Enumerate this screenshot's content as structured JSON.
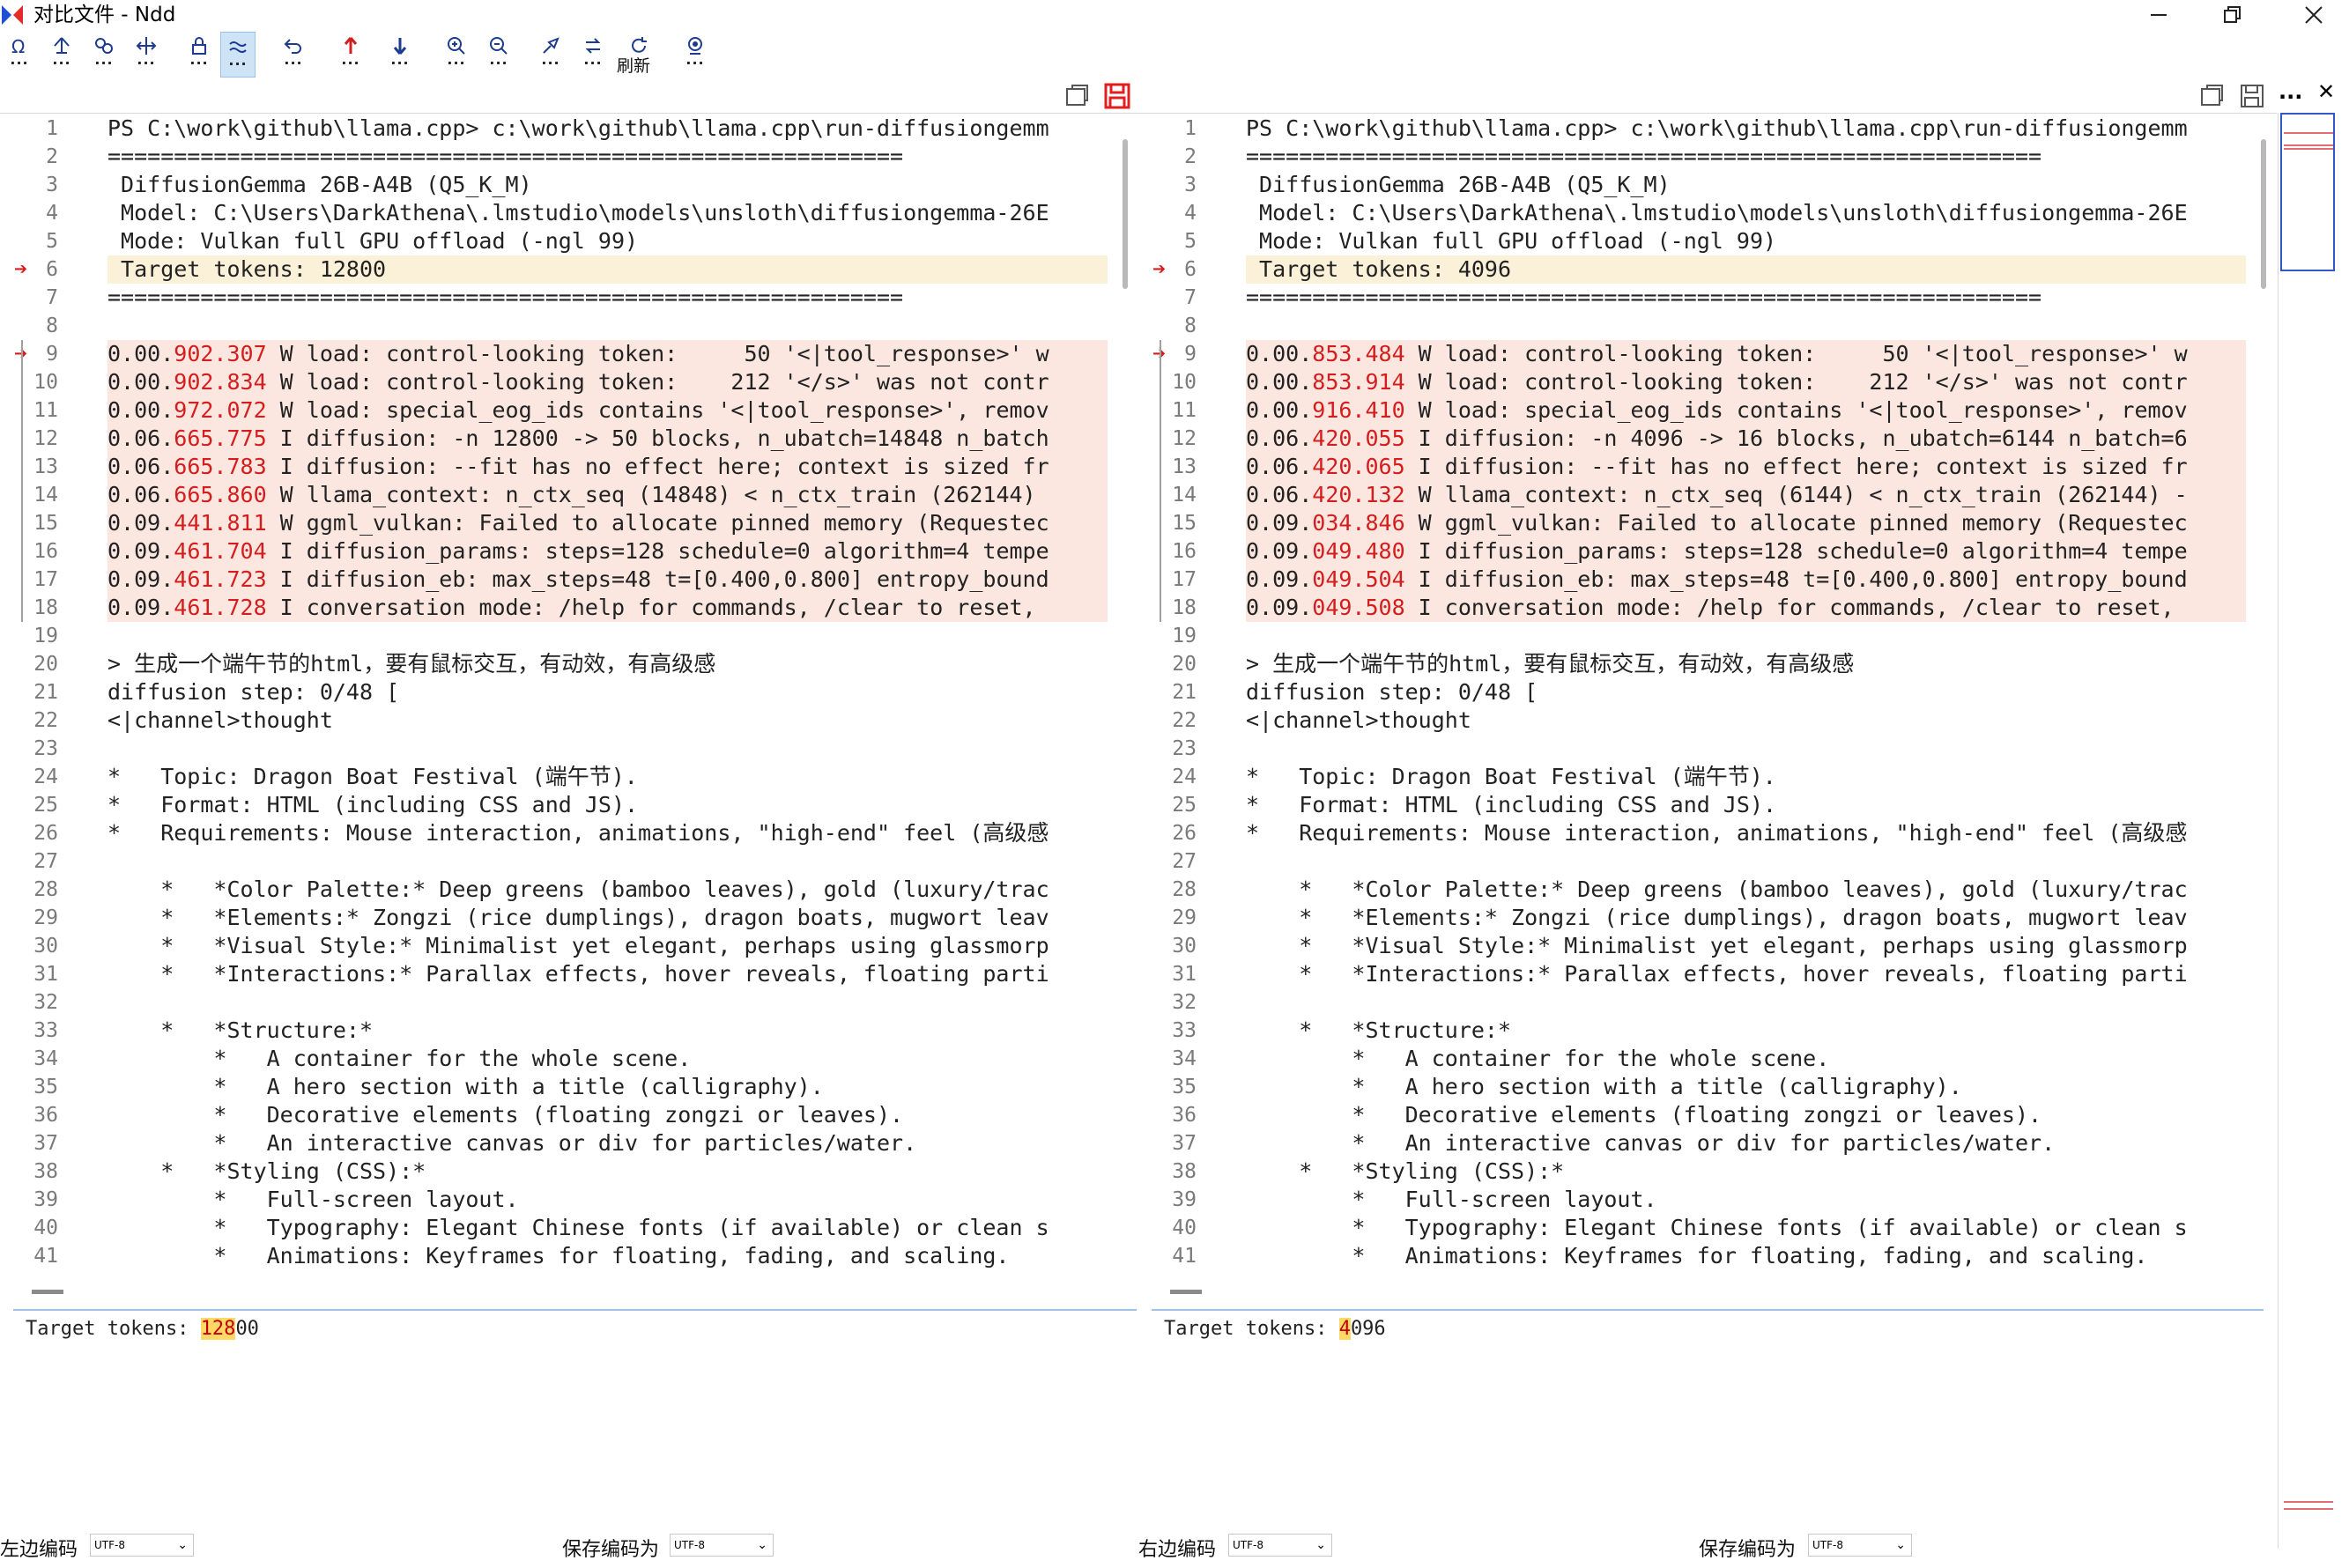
{
  "window": {
    "title": "对比文件 - Ndd",
    "minimize_icon": "minimize-icon",
    "maximize_icon": "restore-icon",
    "close_icon": "close-icon"
  },
  "toolbar": {
    "buttons": [
      {
        "name": "whitespace-icon"
      },
      {
        "name": "prev-diff-block-icon"
      },
      {
        "name": "compare-icon"
      },
      {
        "name": "split-icon"
      },
      {
        "name": "lock-icon"
      },
      {
        "name": "approx-equal-icon"
      },
      {
        "name": "undo-icon"
      },
      {
        "name": "prev-diff-icon"
      },
      {
        "name": "next-diff-icon"
      },
      {
        "name": "zoom-in-icon"
      },
      {
        "name": "zoom-out-icon"
      },
      {
        "name": "clear-icon"
      },
      {
        "name": "sync-icon"
      },
      {
        "name": "refresh-icon"
      },
      {
        "name": "settings-icon"
      }
    ],
    "refresh_label": "刷新"
  },
  "left": {
    "lines": [
      "PS C:\\work\\github\\llama.cpp> c:\\work\\github\\llama.cpp\\run-diffusiongemm",
      "============================================================",
      " DiffusionGemma 26B-A4B (Q5_K_M)",
      " Model: C:\\Users\\DarkAthena\\.lmstudio\\models\\unsloth\\diffusiongemma-26E",
      " Mode: Vulkan full GPU offload (-ngl 99)",
      " Target tokens: 12800",
      "============================================================",
      "",
      "0.00.902.307 W load: control-looking token:     50 '<|tool_response>' w",
      "0.00.902.834 W load: control-looking token:    212 '</s>' was not contr",
      "0.00.972.072 W load: special_eog_ids contains '<|tool_response>', remov",
      "0.06.665.775 I diffusion: -n 12800 -> 50 blocks, n_ubatch=14848 n_batch",
      "0.06.665.783 I diffusion: --fit has no effect here; context is sized fr",
      "0.06.665.860 W llama_context: n_ctx_seq (14848) < n_ctx_train (262144) ",
      "0.09.441.811 W ggml_vulkan: Failed to allocate pinned memory (Requestec",
      "0.09.461.704 I diffusion_params: steps=128 schedule=0 algorithm=4 tempe",
      "0.09.461.723 I diffusion_eb: max_steps=48 t=[0.400,0.800] entropy_bound",
      "0.09.461.728 I conversation mode: /help for commands, /clear to reset,",
      "",
      "> 生成一个端午节的html，要有鼠标交互，有动效，有高级感",
      "diffusion step: 0/48 [",
      "<|channel>thought",
      "",
      "*   Topic: Dragon Boat Festival (端午节).",
      "*   Format: HTML (including CSS and JS).",
      "*   Requirements: Mouse interaction, animations, \"high-end\" feel (高级感",
      "",
      "    *   *Color Palette:* Deep greens (bamboo leaves), gold (luxury/trac",
      "    *   *Elements:* Zongzi (rice dumplings), dragon boats, mugwort leav",
      "    *   *Visual Style:* Minimalist yet elegant, perhaps using glassmorp",
      "    *   *Interactions:* Parallax effects, hover reveals, floating parti",
      "",
      "    *   *Structure:*",
      "        *   A container for the whole scene.",
      "        *   A hero section with a title (calligraphy).",
      "        *   Decorative elements (floating zongzi or leaves).",
      "        *   An interactive canvas or div for particles/water.",
      "    *   *Styling (CSS):*",
      "        *   Full-screen layout.",
      "        *   Typography: Elegant Chinese fonts (if available) or clean s",
      "        *   Animations: Keyframes for floating, fading, and scaling."
    ],
    "detail_prefix": "Target tokens: ",
    "detail_changed": "128",
    "detail_suffix": "00",
    "encoding_label": "左边编码",
    "encoding_value": "UTF-8",
    "save_encoding_label": "保存编码为",
    "save_encoding_value": "UTF-8"
  },
  "right": {
    "lines": [
      "PS C:\\work\\github\\llama.cpp> c:\\work\\github\\llama.cpp\\run-diffusiongemm",
      "============================================================",
      " DiffusionGemma 26B-A4B (Q5_K_M)",
      " Model: C:\\Users\\DarkAthena\\.lmstudio\\models\\unsloth\\diffusiongemma-26E",
      " Mode: Vulkan full GPU offload (-ngl 99)",
      " Target tokens: 4096",
      "============================================================",
      "",
      "0.00.853.484 W load: control-looking token:     50 '<|tool_response>' w",
      "0.00.853.914 W load: control-looking token:    212 '</s>' was not contr",
      "0.00.916.410 W load: special_eog_ids contains '<|tool_response>', remov",
      "0.06.420.055 I diffusion: -n 4096 -> 16 blocks, n_ubatch=6144 n_batch=6",
      "0.06.420.065 I diffusion: --fit has no effect here; context is sized fr",
      "0.06.420.132 W llama_context: n_ctx_seq (6144) < n_ctx_train (262144) -",
      "0.09.034.846 W ggml_vulkan: Failed to allocate pinned memory (Requestec",
      "0.09.049.480 I diffusion_params: steps=128 schedule=0 algorithm=4 tempe",
      "0.09.049.504 I diffusion_eb: max_steps=48 t=[0.400,0.800] entropy_bound",
      "0.09.049.508 I conversation mode: /help for commands, /clear to reset,",
      "",
      "> 生成一个端午节的html，要有鼠标交互，有动效，有高级感",
      "diffusion step: 0/48 [",
      "<|channel>thought",
      "",
      "*   Topic: Dragon Boat Festival (端午节).",
      "*   Format: HTML (including CSS and JS).",
      "*   Requirements: Mouse interaction, animations, \"high-end\" feel (高级感",
      "",
      "    *   *Color Palette:* Deep greens (bamboo leaves), gold (luxury/trac",
      "    *   *Elements:* Zongzi (rice dumplings), dragon boats, mugwort leav",
      "    *   *Visual Style:* Minimalist yet elegant, perhaps using glassmorp",
      "    *   *Interactions:* Parallax effects, hover reveals, floating parti",
      "",
      "    *   *Structure:*",
      "        *   A container for the whole scene.",
      "        *   A hero section with a title (calligraphy).",
      "        *   Decorative elements (floating zongzi or leaves).",
      "        *   An interactive canvas or div for particles/water.",
      "    *   *Styling (CSS):*",
      "        *   Full-screen layout.",
      "        *   Typography: Elegant Chinese fonts (if available) or clean s",
      "        *   Animations: Keyframes for floating, fading, and scaling."
    ],
    "detail_prefix": "Target tokens: ",
    "detail_changed": "4",
    "detail_suffix": "096",
    "encoding_label": "右边编码",
    "encoding_value": "UTF-8",
    "save_encoding_label": "保存编码为",
    "save_encoding_value": "UTF-8"
  },
  "diff": {
    "changed_lines": [
      6,
      9,
      10,
      11,
      12,
      13,
      14,
      15,
      16,
      17,
      18
    ],
    "current_line": 6,
    "marker_lines": [
      6,
      9
    ],
    "diff_color": "#fbe7e0",
    "current_color": "#fbf0d8",
    "changed_text_color": "#d41e1e"
  },
  "right_more_label": "...",
  "right_close_label": "✕"
}
